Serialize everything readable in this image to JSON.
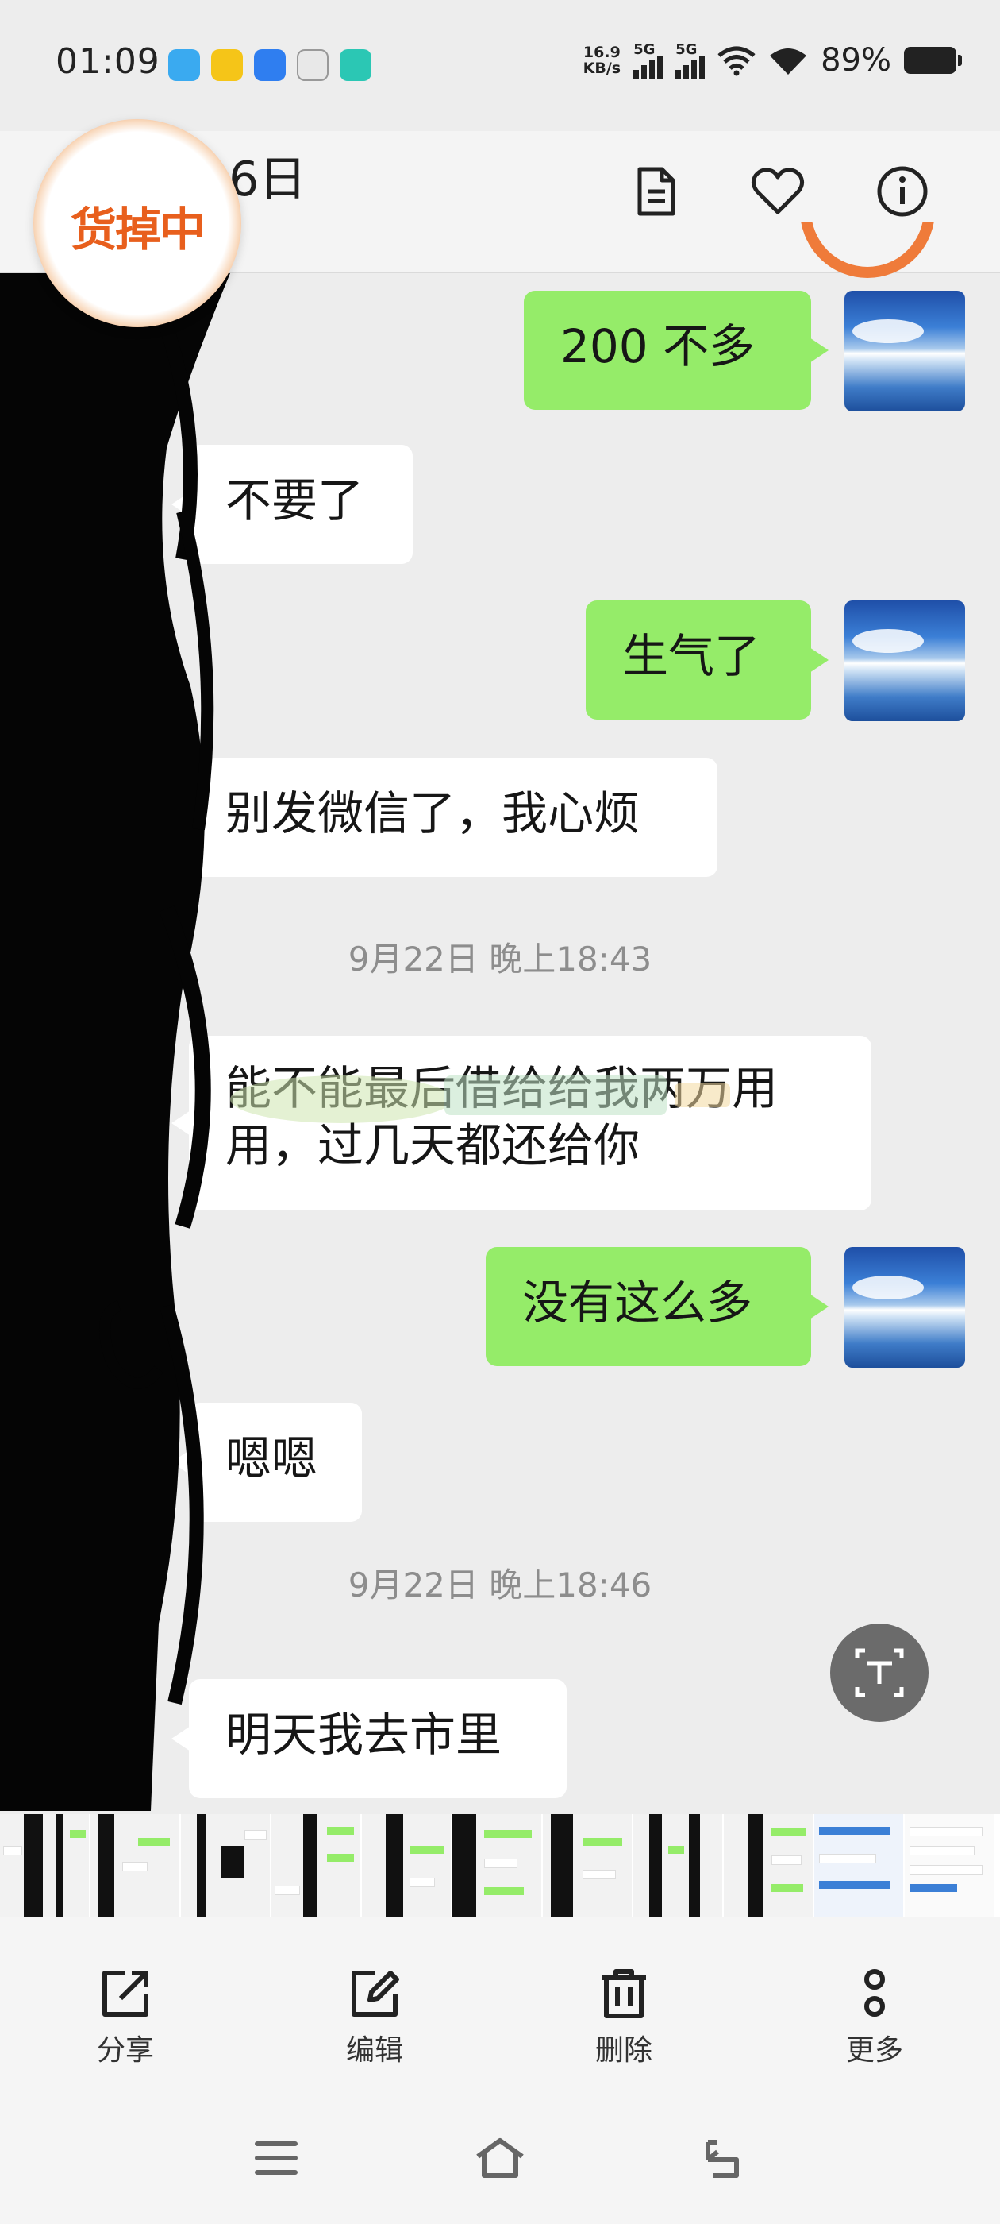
{
  "status_bar": {
    "time": "01:09",
    "net_speed_value": "16.9",
    "net_speed_unit": "KB/s",
    "sim1_label": "5G",
    "sim2_label": "5G",
    "battery_percent": "89%",
    "app_icon_colors": [
      "#3aaaf0",
      "#f5c518",
      "#2f7ef0",
      "#f0f0f0",
      "#2bc7b4"
    ]
  },
  "header": {
    "title": "16日",
    "promo_badge_text": "货掉中",
    "icons": [
      "document-icon",
      "heart-icon",
      "info-icon"
    ]
  },
  "chat": {
    "messages": [
      {
        "side": "sent",
        "text": "200 不多"
      },
      {
        "side": "recv",
        "text": "不要了"
      },
      {
        "side": "sent",
        "text": "生气了"
      },
      {
        "side": "recv",
        "text": "别发微信了，我心烦"
      },
      {
        "type": "timestamp",
        "text": "9月22日 晚上18:43"
      },
      {
        "side": "recv",
        "text": "能不能最后借给给我两万用",
        "text2": "用，过几天都还给你"
      },
      {
        "side": "sent",
        "text": "没有这么多"
      },
      {
        "side": "recv",
        "text": "嗯嗯"
      },
      {
        "type": "timestamp",
        "text": "9月22日 晚上18:46"
      },
      {
        "side": "recv",
        "text": "明天我去市里"
      }
    ],
    "sent_bubble_color": "#95ec69",
    "recv_bubble_color": "#ffffff"
  },
  "toolbar": {
    "share_label": "分享",
    "edit_label": "编辑",
    "delete_label": "删除",
    "more_label": "更多"
  },
  "nav": {
    "items": [
      "menu-icon",
      "home-icon",
      "back-icon"
    ]
  }
}
